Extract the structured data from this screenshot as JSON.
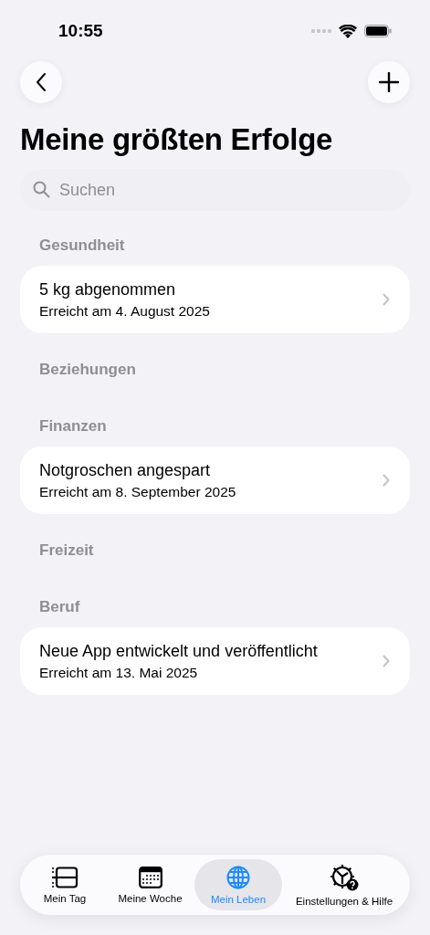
{
  "status_bar": {
    "time": "10:55"
  },
  "title": "Meine größten Erfolge",
  "search": {
    "placeholder": "Suchen"
  },
  "sections": [
    {
      "title": "Gesundheit",
      "items": [
        {
          "title": "5 kg abgenommen",
          "subtitle": "Erreicht am 4. August 2025"
        }
      ]
    },
    {
      "title": "Beziehungen"
    },
    {
      "title": "Finanzen",
      "items": [
        {
          "title": "Notgroschen angespart",
          "subtitle": "Erreicht am 8. September 2025"
        }
      ]
    },
    {
      "title": "Freizeit"
    },
    {
      "title": "Beruf",
      "items": [
        {
          "title": "Neue App entwickelt und veröffentlicht",
          "subtitle": "Erreicht am 13. Mai 2025"
        }
      ]
    }
  ],
  "tabs": [
    {
      "kind": "day",
      "label": "Mein Tag",
      "selected": false
    },
    {
      "kind": "week",
      "label": "Meine Woche",
      "selected": false
    },
    {
      "kind": "life",
      "label": "Mein Leben",
      "selected": true
    },
    {
      "kind": "settings",
      "label": "Einstellungen & Hilfe",
      "selected": false
    }
  ]
}
